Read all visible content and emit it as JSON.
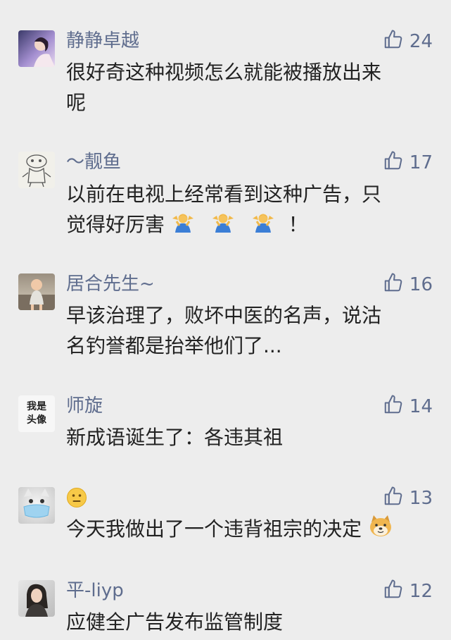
{
  "comments": [
    {
      "name": "静静卓越",
      "likes": "24",
      "lines": [
        "很好奇这种视频怎么就能被播放出来",
        "呢"
      ]
    },
    {
      "name": "～靓鱼",
      "likes": "17",
      "lines": [
        "以前在电视上经常看到这种广告，只",
        "觉得好厉害"
      ],
      "tail": "！"
    },
    {
      "name": "居合先生~",
      "likes": "16",
      "lines": [
        "早该治理了，败坏中医的名声，说沽",
        "名钓誉都是抬举他们了..."
      ]
    },
    {
      "name": "师旋",
      "likes": "14",
      "avatar_text": [
        "我是",
        "头像"
      ],
      "lines": [
        "新成语诞生了：各违其祖"
      ]
    },
    {
      "name": "",
      "likes": "13",
      "lines": [
        "今天我做出了一个违背祖宗的决定"
      ]
    },
    {
      "name": "平-liyp",
      "likes": "12",
      "lines": [
        "应健全广告发布监管制度"
      ]
    }
  ],
  "icons": {
    "like": "thumbs-up-icon",
    "shrug": "person-shrugging-icon",
    "neutral": "neutral-face-icon",
    "doge": "doge-icon"
  },
  "colors": {
    "background": "#ededed",
    "nickname": "#5f6d8e",
    "text": "#222222"
  }
}
